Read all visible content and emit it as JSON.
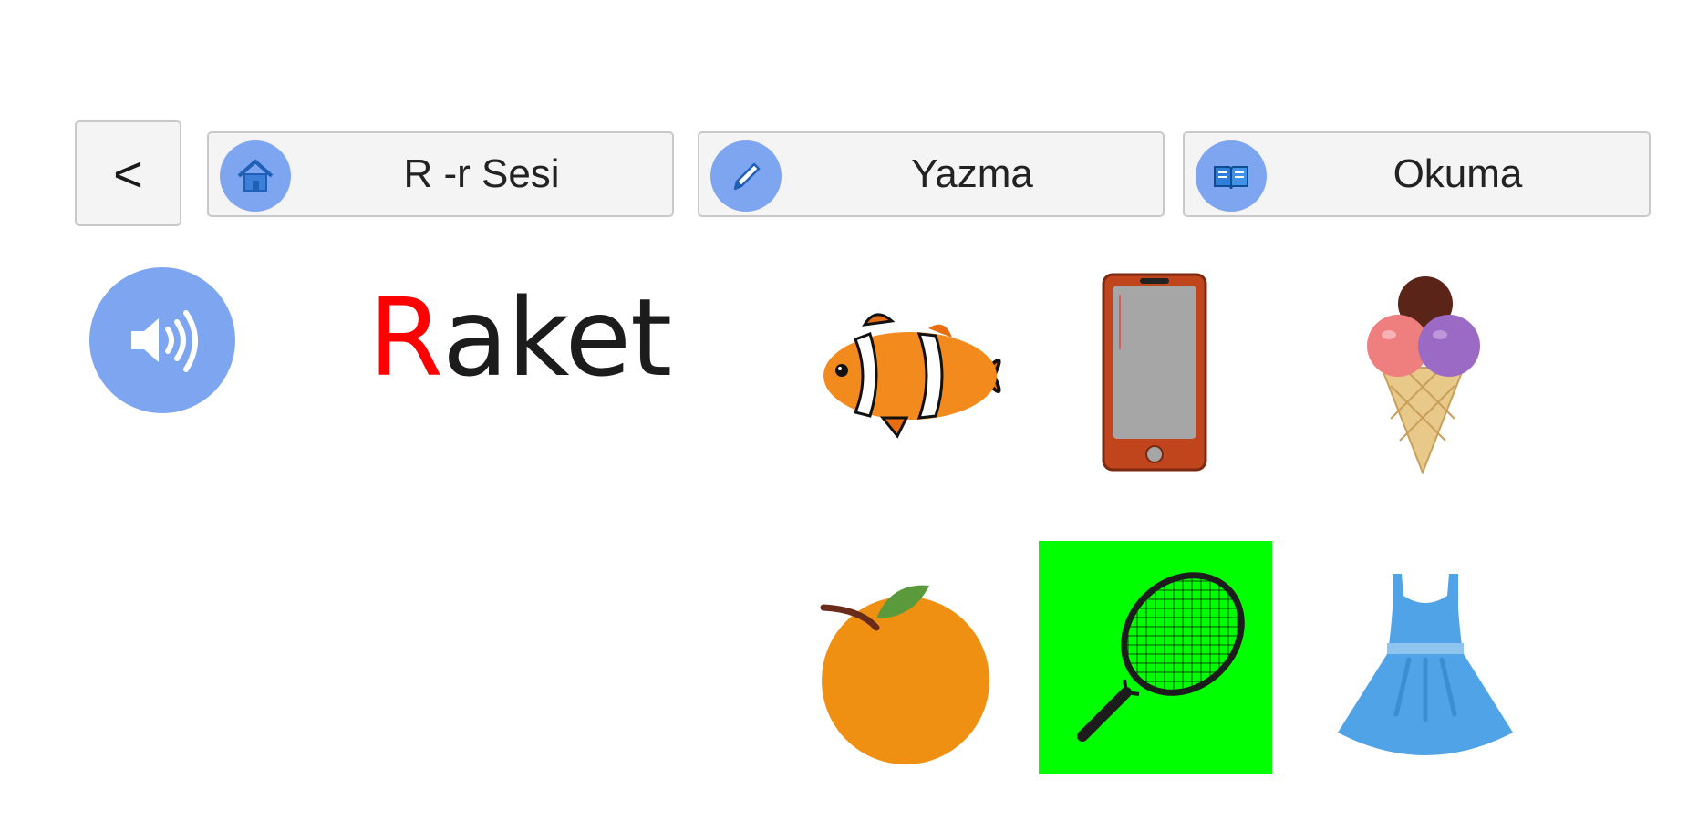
{
  "header": {
    "back_label": "<",
    "buttons": [
      {
        "label": "R -r Sesi",
        "icon": "home-icon"
      },
      {
        "label": "Yazma",
        "icon": "pencil-icon"
      },
      {
        "label": "Okuma",
        "icon": "book-icon"
      }
    ]
  },
  "lesson": {
    "speaker_icon": "speaker-icon",
    "word_first_letter": "R",
    "word_rest": "aket"
  },
  "choices": [
    {
      "item": "clownfish",
      "selected": false
    },
    {
      "item": "phone",
      "selected": false
    },
    {
      "item": "ice-cream",
      "selected": false
    },
    {
      "item": "orange",
      "selected": false
    },
    {
      "item": "racket",
      "selected": true
    },
    {
      "item": "dress",
      "selected": false
    }
  ],
  "colors": {
    "selected_bg": "#00ff00",
    "accent_circle": "#7ea6f0",
    "highlight_letter": "#ff0000"
  }
}
